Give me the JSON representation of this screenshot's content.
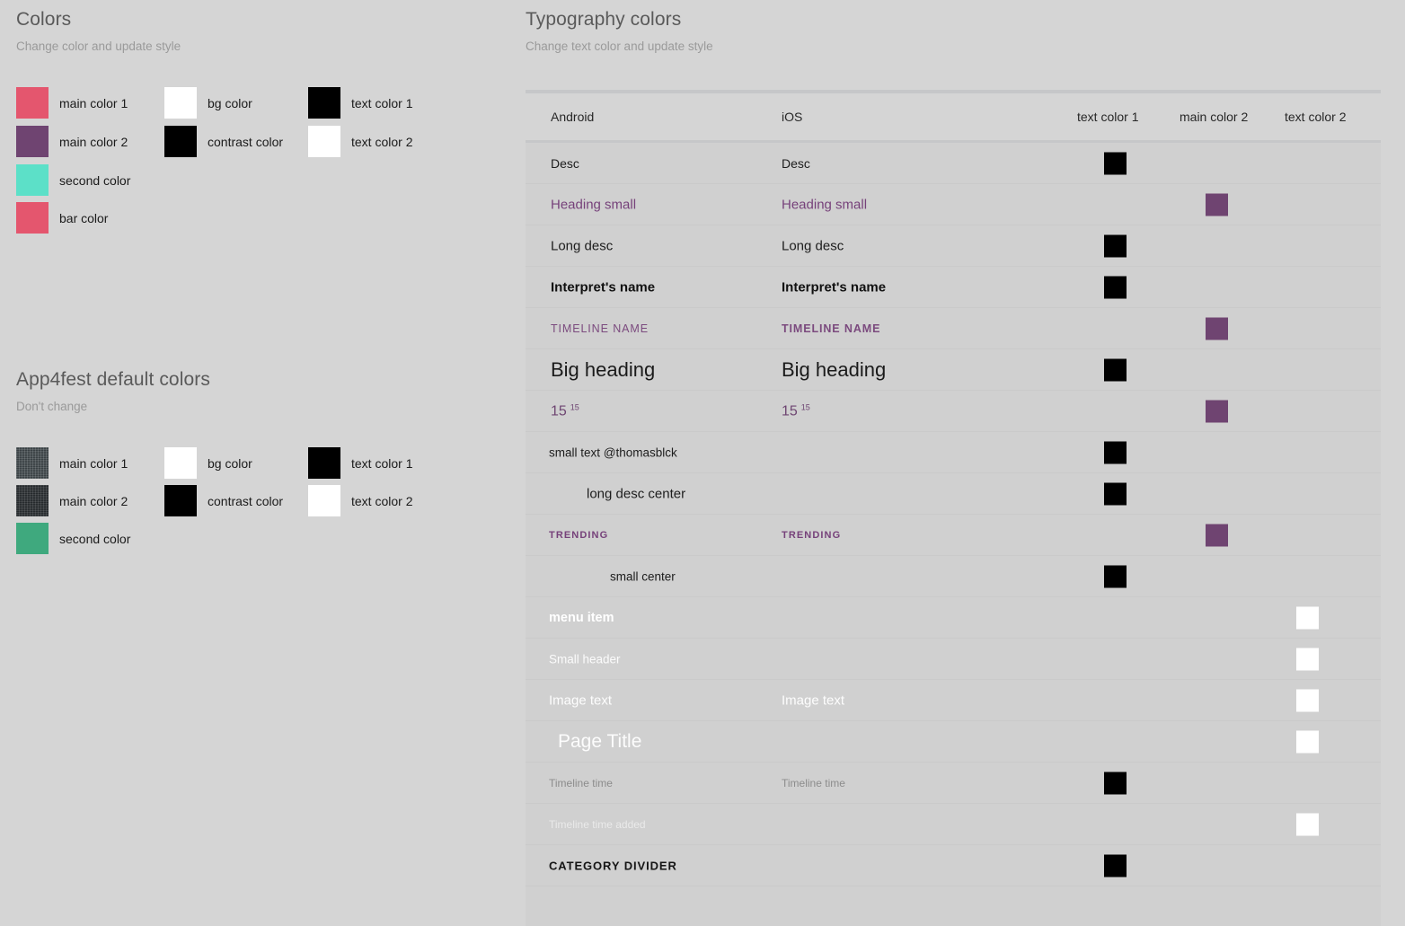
{
  "left": {
    "colors": {
      "title": "Colors",
      "subtitle": "Change color and update style",
      "swatches": [
        {
          "label": "main color 1",
          "hex": "#e4566e"
        },
        {
          "label": "main color 2",
          "hex": "#6f4471"
        },
        {
          "label": "second color",
          "hex": "#5ce0c8"
        },
        {
          "label": "bar color",
          "hex": "#e4566e"
        },
        {
          "label": "bg color",
          "hex": "#ffffff"
        },
        {
          "label": "contrast color",
          "hex": "#000000"
        },
        {
          "label": "text color 1",
          "hex": "#000000"
        },
        {
          "label": "text color 2",
          "hex": "#ffffff"
        }
      ]
    },
    "defaults": {
      "title": "App4fest default colors",
      "subtitle": "Don't change",
      "swatches": [
        {
          "label": "main color 1",
          "hex": "#3f474b"
        },
        {
          "label": "main color 2",
          "hex": "#2b3033"
        },
        {
          "label": "second color",
          "hex": "#3fa97e"
        },
        {
          "label": "bg color",
          "hex": "#ffffff"
        },
        {
          "label": "contrast color",
          "hex": "#000000"
        },
        {
          "label": "text color 1",
          "hex": "#000000"
        },
        {
          "label": "text color 2",
          "hex": "#ffffff"
        }
      ]
    }
  },
  "right": {
    "typography": {
      "title": "Typography colors",
      "subtitle": "Change text color and update style"
    },
    "table": {
      "headers": {
        "android": "Android",
        "ios": "iOS",
        "text_color_1": "text color 1",
        "main_color_2": "main color 2",
        "text_color_2": "text color 2"
      },
      "rows": [
        {
          "android": "Desc",
          "ios": "Desc",
          "swatch": "text_color_1"
        },
        {
          "android": "Heading small",
          "ios": "Heading small",
          "swatch": "main_color_2"
        },
        {
          "android": "Long desc",
          "ios": "Long desc",
          "swatch": "text_color_1"
        },
        {
          "android": "Interpret's name",
          "ios": "Interpret's name",
          "swatch": "text_color_1"
        },
        {
          "android": "TIMELINE NAME",
          "ios": "TIMELINE NAME",
          "swatch": "main_color_2"
        },
        {
          "android": "Big heading",
          "ios": "Big heading",
          "swatch": "text_color_1"
        },
        {
          "android": "15",
          "ios": "15",
          "android_sup": "15",
          "ios_sup": "15",
          "swatch": "main_color_2"
        },
        {
          "android": "small text  @thomasblck",
          "ios": "",
          "swatch": "text_color_1"
        },
        {
          "android": "long desc center",
          "ios": "",
          "swatch": "text_color_1"
        },
        {
          "android": "TRENDING",
          "ios": "TRENDING",
          "swatch": "main_color_2"
        },
        {
          "android": "small center",
          "ios": "",
          "swatch": "text_color_1"
        },
        {
          "android": "menu item",
          "ios": "",
          "swatch": "text_color_2"
        },
        {
          "android": "Small header",
          "ios": "",
          "swatch": "text_color_2"
        },
        {
          "android": "Image text",
          "ios": "Image text",
          "swatch": "text_color_2"
        },
        {
          "android": "Page Title",
          "ios": "",
          "swatch": "text_color_2"
        },
        {
          "android": "Timeline time",
          "ios": "Timeline time",
          "swatch": "text_color_1"
        },
        {
          "android": "Timeline time added",
          "ios": "",
          "swatch": "text_color_2"
        },
        {
          "android": "CATEGORY DIVIDER",
          "ios": "",
          "swatch": "text_color_1"
        },
        {
          "android": "",
          "ios": "",
          "swatch": ""
        }
      ]
    }
  },
  "palette": {
    "page_bg": "#d5d5d5",
    "table_row_bg": "#d0d0d0",
    "divider": "#cacaca",
    "swatch_black": "#000000",
    "swatch_white": "#ffffff",
    "swatch_purple": "#6f4471"
  }
}
